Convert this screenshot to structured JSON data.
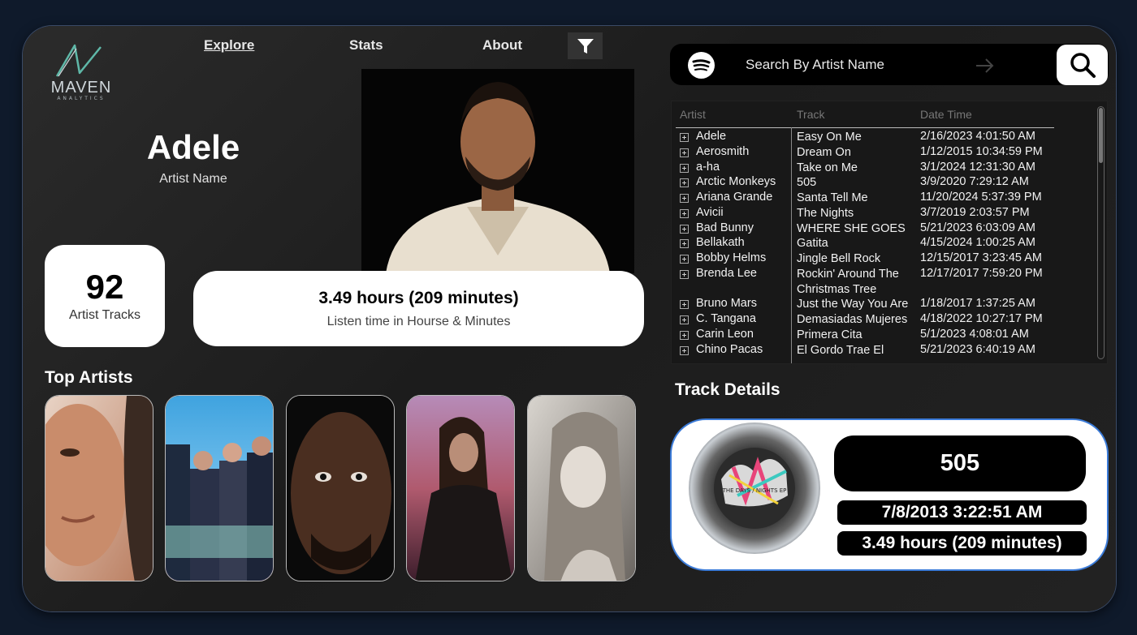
{
  "logo": {
    "brand": "MAVEN",
    "sub": "ANALYTICS"
  },
  "nav": {
    "explore": "Explore",
    "stats": "Stats",
    "about": "About"
  },
  "artist": {
    "name": "Adele",
    "name_label": "Artist Name"
  },
  "kpis": {
    "tracks_value": "92",
    "tracks_label": "Artist Tracks",
    "time_value": "3.49 hours (209 minutes)",
    "time_label": "Listen time in Hourse & Minutes"
  },
  "top_artists": {
    "title": "Top Artists"
  },
  "search": {
    "placeholder": "Search By Artist Name"
  },
  "table": {
    "headers": [
      "Artist",
      "Track",
      "Date Time"
    ],
    "rows": [
      {
        "artist": "Adele",
        "track": "Easy On Me",
        "date": "2/16/2023 4:01:50 AM"
      },
      {
        "artist": "Aerosmith",
        "track": "Dream On",
        "date": "1/12/2015 10:34:59 PM"
      },
      {
        "artist": "a-ha",
        "track": "Take on Me",
        "date": "3/1/2024 12:31:30 AM"
      },
      {
        "artist": "Arctic Monkeys",
        "track": "505",
        "date": "3/9/2020 7:29:12 AM"
      },
      {
        "artist": "Ariana Grande",
        "track": "Santa Tell Me",
        "date": "11/20/2024 5:37:39 PM"
      },
      {
        "artist": "Avicii",
        "track": "The Nights",
        "date": "3/7/2019 2:03:57 PM"
      },
      {
        "artist": "Bad Bunny",
        "track": "WHERE SHE GOES",
        "date": "5/21/2023 6:03:09 AM"
      },
      {
        "artist": "Bellakath",
        "track": "Gatita",
        "date": "4/15/2024 1:00:25 AM"
      },
      {
        "artist": "Bobby Helms",
        "track": "Jingle Bell Rock",
        "date": "12/15/2017 3:23:45 AM"
      },
      {
        "artist": "Brenda Lee",
        "track": "Rockin' Around The Christmas Tree",
        "date": "12/17/2017 7:59:20 PM"
      },
      {
        "artist": "Bruno Mars",
        "track": "Just the Way You Are",
        "date": "1/18/2017 1:37:25 AM"
      },
      {
        "artist": "C. Tangana",
        "track": "Demasiadas Mujeres",
        "date": "4/18/2022 10:27:17 PM"
      },
      {
        "artist": "Carin Leon",
        "track": "Primera Cita",
        "date": "5/1/2023 4:08:01 AM"
      },
      {
        "artist": "Chino Pacas",
        "track": "El Gordo Trae El",
        "date": "5/21/2023 6:40:19 AM"
      }
    ]
  },
  "track_details": {
    "title": "Track Details",
    "track": "505",
    "date": "7/8/2013 3:22:51 AM",
    "time": "3.49 hours (209 minutes)",
    "album_art_text": "THE DAYS / NIGHTS EP"
  },
  "colors": {
    "accent_border": "#3b7bd8",
    "background": "#0f1a2b"
  }
}
